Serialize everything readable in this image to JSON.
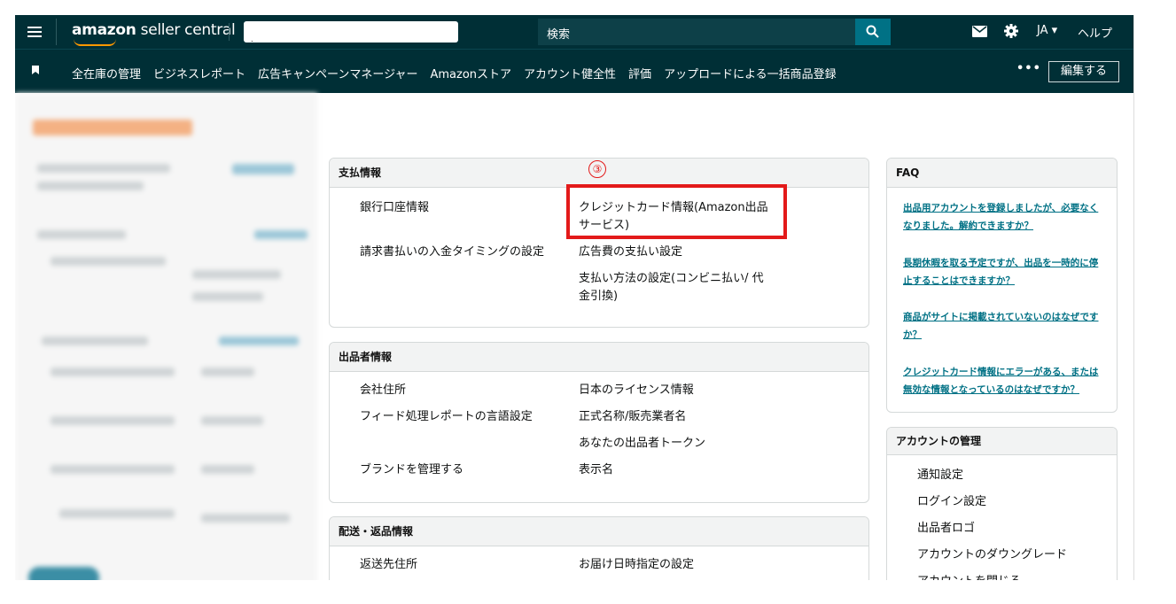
{
  "header": {
    "logo_brand": "amazon",
    "logo_rest": "seller central",
    "search_placeholder": "検索",
    "language": "JA",
    "help": "ヘルプ"
  },
  "nav": {
    "items": [
      "全在庫の管理",
      "ビジネスレポート",
      "広告キャンペーンマネージャー",
      "Amazonストア",
      "アカウント健全性",
      "評価",
      "アップロードによる一括商品登録"
    ],
    "more": "•••",
    "edit": "編集する"
  },
  "payment": {
    "title": "支払情報",
    "links": [
      "銀行口座情報",
      "請求書払いの入金タイミングの設定",
      "クレジットカード情報(Amazon出品サービス)",
      "広告費の支払い設定",
      "支払い方法の設定(コンビニ払い/ 代金引換)"
    ]
  },
  "seller": {
    "title": "出品者情報",
    "links": [
      "会社住所",
      "フィード処理レポートの言語設定",
      "ブランドを管理する",
      "日本のライセンス情報",
      "正式名称/販売業者名",
      "あなたの出品者トークン",
      "表示名"
    ]
  },
  "shipping": {
    "title": "配送・返品情報",
    "links": [
      "返送先住所",
      "お届け日時指定の設定"
    ]
  },
  "faq": {
    "title": "FAQ",
    "items": [
      "出品用アカウントを登録しましたが、必要なくなりました。解約できますか？",
      "長期休暇を取る予定ですが、出品を一時的に停止することはできますか？",
      "商品がサイトに掲載されていないのはなぜですか？",
      "クレジットカード情報にエラーがある、または無効な情報となっているのはなぜですか？"
    ]
  },
  "account": {
    "title": "アカウントの管理",
    "links": [
      "通知設定",
      "ログイン設定",
      "出品者ロゴ",
      "アカウントのダウングレード",
      "アカウントを閉じる"
    ]
  },
  "annotation": {
    "marker": "③"
  }
}
